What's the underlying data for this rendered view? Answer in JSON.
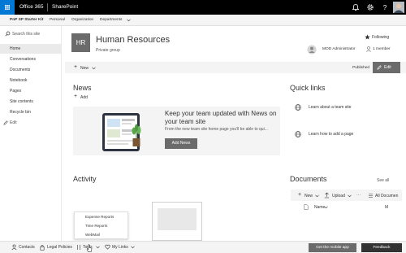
{
  "suite": {
    "app": "Office 365",
    "product": "SharePoint",
    "bg": "#000000",
    "waffle_color": "#0078d4"
  },
  "hub": {
    "title": "PnP SP Starter Kit",
    "links": [
      "Personal",
      "Organization",
      "Departments"
    ]
  },
  "nav": {
    "search_placeholder": "Search this site",
    "items": [
      "Home",
      "Conversations",
      "Documents",
      "Notebook",
      "Pages",
      "Site contents",
      "Recycle bin"
    ],
    "edit": "Edit"
  },
  "site": {
    "initials": "HR",
    "title": "Human Resources",
    "subtitle": "Private group",
    "following": "Following",
    "user": "MOD Administrator",
    "members": "1 member"
  },
  "command": {
    "new": "New",
    "published": "Published",
    "edit": "Edit"
  },
  "news": {
    "heading": "News",
    "add": "Add",
    "banner_title": "Keep your team updated with News on your team site",
    "banner_text": "From the new team site home page you'll be able to qui...",
    "add_news": "Add News"
  },
  "quicklinks": {
    "heading": "Quick links",
    "items": [
      "Learn about a team site",
      "Learn how to add a page"
    ]
  },
  "activity": {
    "heading": "Activity"
  },
  "documents": {
    "heading": "Documents",
    "see_all": "See all",
    "new": "New",
    "upload": "Upload",
    "all_documents": "All Documen",
    "col_name": "Name"
  },
  "dropdown": {
    "options": [
      "Expense Reports",
      "Time Reports",
      "WebMail"
    ]
  },
  "footer": {
    "contacts": "Contacts",
    "legal": "Legal Policies",
    "tools": "Tools",
    "mylinks": "My Links",
    "mobile": "Get the mobile app",
    "feedback": "Feedback"
  }
}
